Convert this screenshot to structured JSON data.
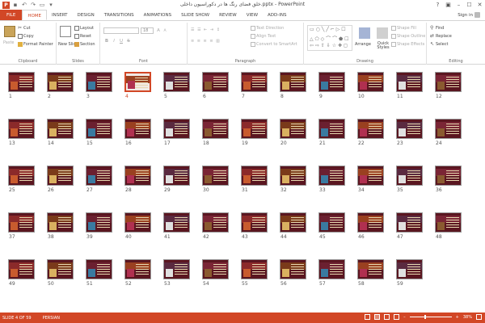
{
  "window": {
    "title": "خلق فضای رنگ ها در دکوراسیون داخلی.pptx - PowerPoint",
    "app_logo": "P",
    "minimize": "–",
    "maximize": "☐",
    "close": "✕",
    "help": "?"
  },
  "tabs": [
    {
      "label": "FILE"
    },
    {
      "label": "HOME"
    },
    {
      "label": "INSERT"
    },
    {
      "label": "DESIGN"
    },
    {
      "label": "TRANSITIONS"
    },
    {
      "label": "ANIMATIONS"
    },
    {
      "label": "SLIDE SHOW"
    },
    {
      "label": "REVIEW"
    },
    {
      "label": "VIEW"
    },
    {
      "label": "ADD-INS"
    }
  ],
  "signin": "Sign in",
  "ribbon": {
    "clipboard": {
      "label": "Clipboard",
      "paste": "Paste",
      "cut": "Cut",
      "copy": "Copy",
      "format_painter": "Format Painter"
    },
    "slides": {
      "label": "Slides",
      "new_slide": "New Slide",
      "layout": "Layout",
      "reset": "Reset",
      "section": "Section"
    },
    "font": {
      "label": "Font",
      "font_name": "",
      "font_size": "18",
      "bold": "B",
      "italic": "I",
      "underline": "U",
      "strike": "S",
      "grow": "A",
      "shrink": "A"
    },
    "paragraph": {
      "label": "Paragraph",
      "text_direction": "Text Direction",
      "align_text": "Align Text",
      "convert_smartart": "Convert to SmartArt"
    },
    "drawing": {
      "label": "Drawing",
      "arrange": "Arrange",
      "quick_styles": "Quick Styles",
      "shape_fill": "Shape Fill",
      "shape_outline": "Shape Outline",
      "shape_effects": "Shape Effects"
    },
    "editing": {
      "label": "Editing",
      "find": "Find",
      "replace": "Replace",
      "select": "Select"
    }
  },
  "slides": {
    "selected": 4,
    "count": 59
  },
  "status": {
    "slide_info": "SLIDE 4 OF 59",
    "language": "PERSIAN",
    "zoom": "38%",
    "zoom_minus": "–",
    "zoom_plus": "+"
  },
  "colors": {
    "accent": "#d24726",
    "slide_bg": "#5a1620"
  }
}
